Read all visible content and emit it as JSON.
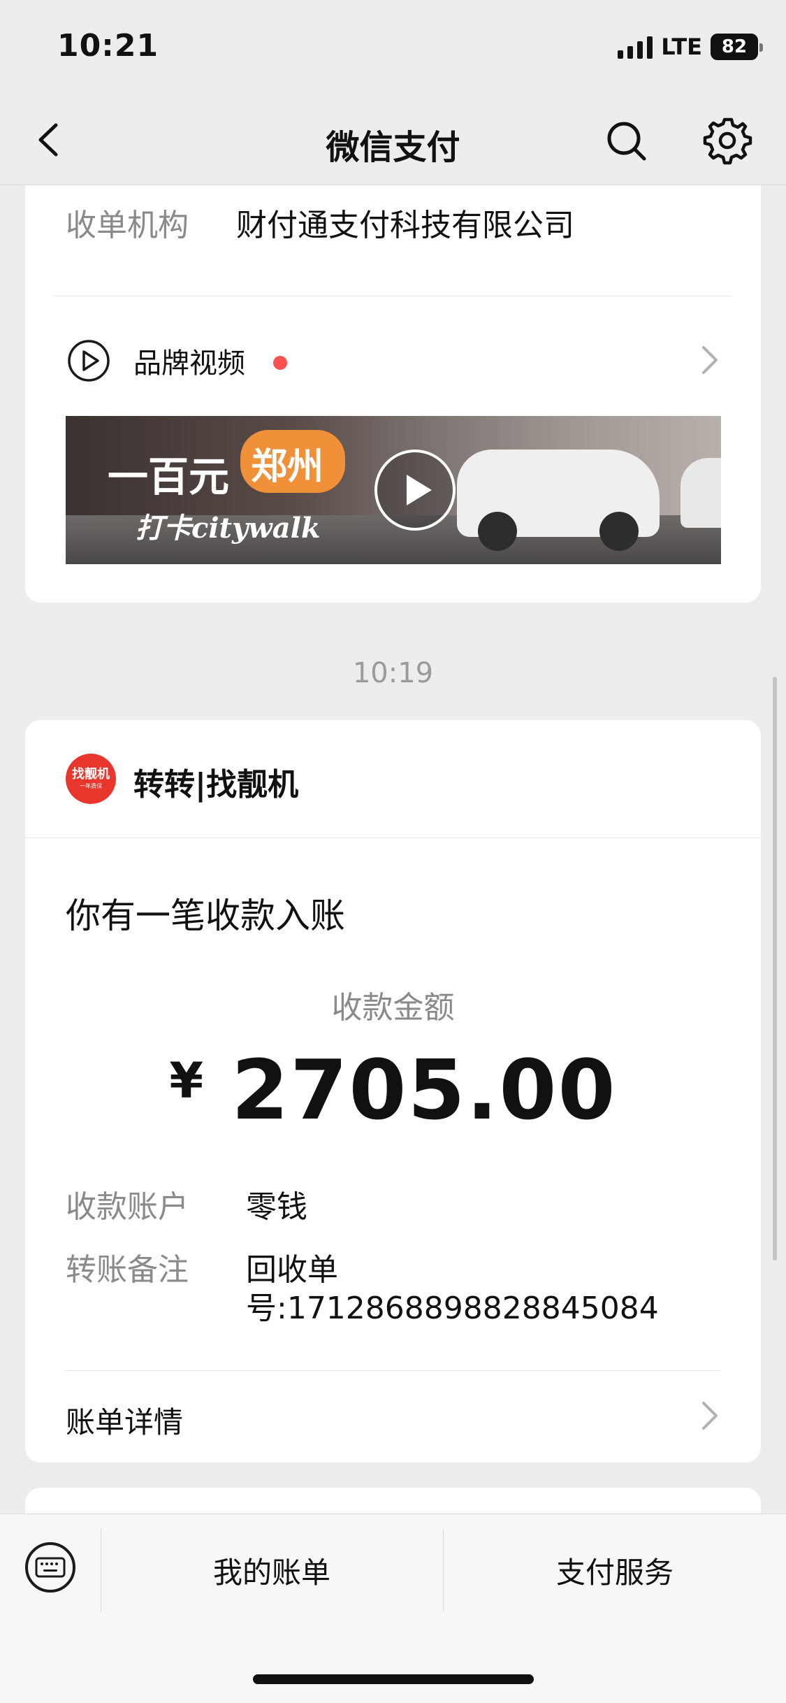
{
  "status_bar": {
    "time": "10:21",
    "network": "LTE",
    "battery": "82"
  },
  "nav": {
    "title": "微信支付",
    "back_icon": "chevron-left-icon",
    "search_icon": "search-icon",
    "settings_icon": "gear-icon"
  },
  "card_top": {
    "acquirer_label": "收单机构",
    "acquirer_value": "财付通支付科技有限公司",
    "brand_video_label": "品牌视频",
    "video_overlay_line1": "一百元",
    "video_overlay_badge": "郑州",
    "video_overlay_line2": "打卡citywalk"
  },
  "timestamp": "10:19",
  "payment_notice": {
    "merchant_logo_text": "找靓机",
    "merchant_logo_subtext": "一年质保",
    "merchant_name": "转转|找靓机",
    "title": "你有一笔收款入账",
    "amount_label": "收款金额",
    "currency": "¥",
    "amount": "2705.00",
    "account_label": "收款账户",
    "account_value": "零钱",
    "remark_label": "转账备注",
    "remark_value_line1": "回收单",
    "remark_value_line2": "号:1712868898828845084",
    "detail_link": "账单详情"
  },
  "bottom_bar": {
    "keyboard_icon": "keyboard-icon",
    "tab1": "我的账单",
    "tab2": "支付服务"
  },
  "colors": {
    "background": "#ededed",
    "card": "#ffffff",
    "secondary_text": "#8a8a8a",
    "red_dot": "#fa5151",
    "merchant_logo": "#e8362d"
  }
}
